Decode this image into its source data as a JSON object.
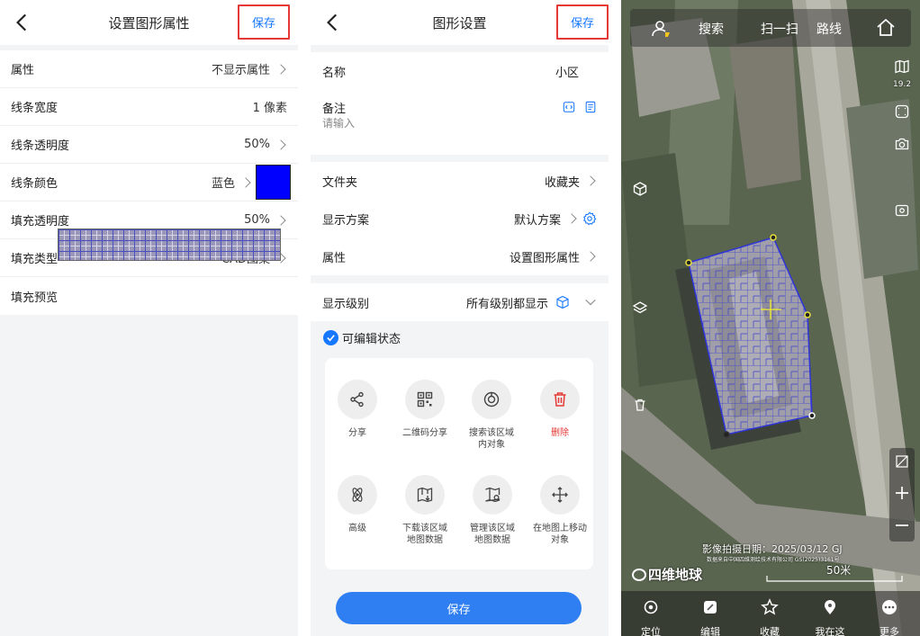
{
  "panel1": {
    "title": "设置图形属性",
    "save": "保存",
    "rows": [
      {
        "label": "属性",
        "value": "不显示属性"
      },
      {
        "label": "线条宽度",
        "value": "1 像素"
      },
      {
        "label": "线条透明度",
        "value": "50%"
      },
      {
        "label": "线条颜色",
        "value": "蓝色"
      },
      {
        "label": "填充透明度",
        "value": "50%"
      },
      {
        "label": "填充类型",
        "value": "CAD图案"
      },
      {
        "label": "填充预览",
        "value": ""
      }
    ],
    "swatch_color": "#0000ff"
  },
  "panel2": {
    "title": "图形设置",
    "save": "保存",
    "name": {
      "label": "名称",
      "value": "小区"
    },
    "note": {
      "label": "备注",
      "placeholder": "请输入"
    },
    "folder": {
      "label": "文件夹",
      "value": "收藏夹"
    },
    "scheme": {
      "label": "显示方案",
      "value": "默认方案"
    },
    "attr": {
      "label": "属性",
      "value": "设置图形属性"
    },
    "level": {
      "label": "显示级别",
      "value": "所有级别都显示"
    },
    "editable": "可编辑状态",
    "tools": [
      {
        "label": "分享",
        "icon": "share-icon"
      },
      {
        "label": "二维码分享",
        "icon": "qrcode-icon"
      },
      {
        "label": "搜索该区域内对象",
        "icon": "search-area-icon"
      },
      {
        "label": "删除",
        "icon": "trash-icon"
      },
      {
        "label": "高级",
        "icon": "advanced-icon"
      },
      {
        "label": "下载该区域地图数据",
        "icon": "download-map-icon"
      },
      {
        "label": "管理该区域地图数据",
        "icon": "manage-map-icon"
      },
      {
        "label": "在地图上移动对象",
        "icon": "move-icon"
      }
    ],
    "bottom_save": "保存",
    "accent": "#1677ff",
    "danger": "#e53935"
  },
  "panel3": {
    "topbar": {
      "search": "搜索",
      "scan": "扫一扫",
      "route": "路线"
    },
    "zoom_level": "19.2",
    "capture_date": "影像拍摄日期：2025/03/12 GJ",
    "source": "数据来自中国四维测绘技术有限公司 GS(2025)3161号",
    "logo": "四维地球",
    "scale": "50米",
    "bottom": [
      {
        "label": "定位",
        "icon": "locate-icon"
      },
      {
        "label": "编辑",
        "icon": "edit-icon"
      },
      {
        "label": "收藏",
        "icon": "star-icon"
      },
      {
        "label": "我在这",
        "icon": "pin-icon"
      },
      {
        "label": "更多",
        "icon": "more-icon"
      }
    ]
  }
}
